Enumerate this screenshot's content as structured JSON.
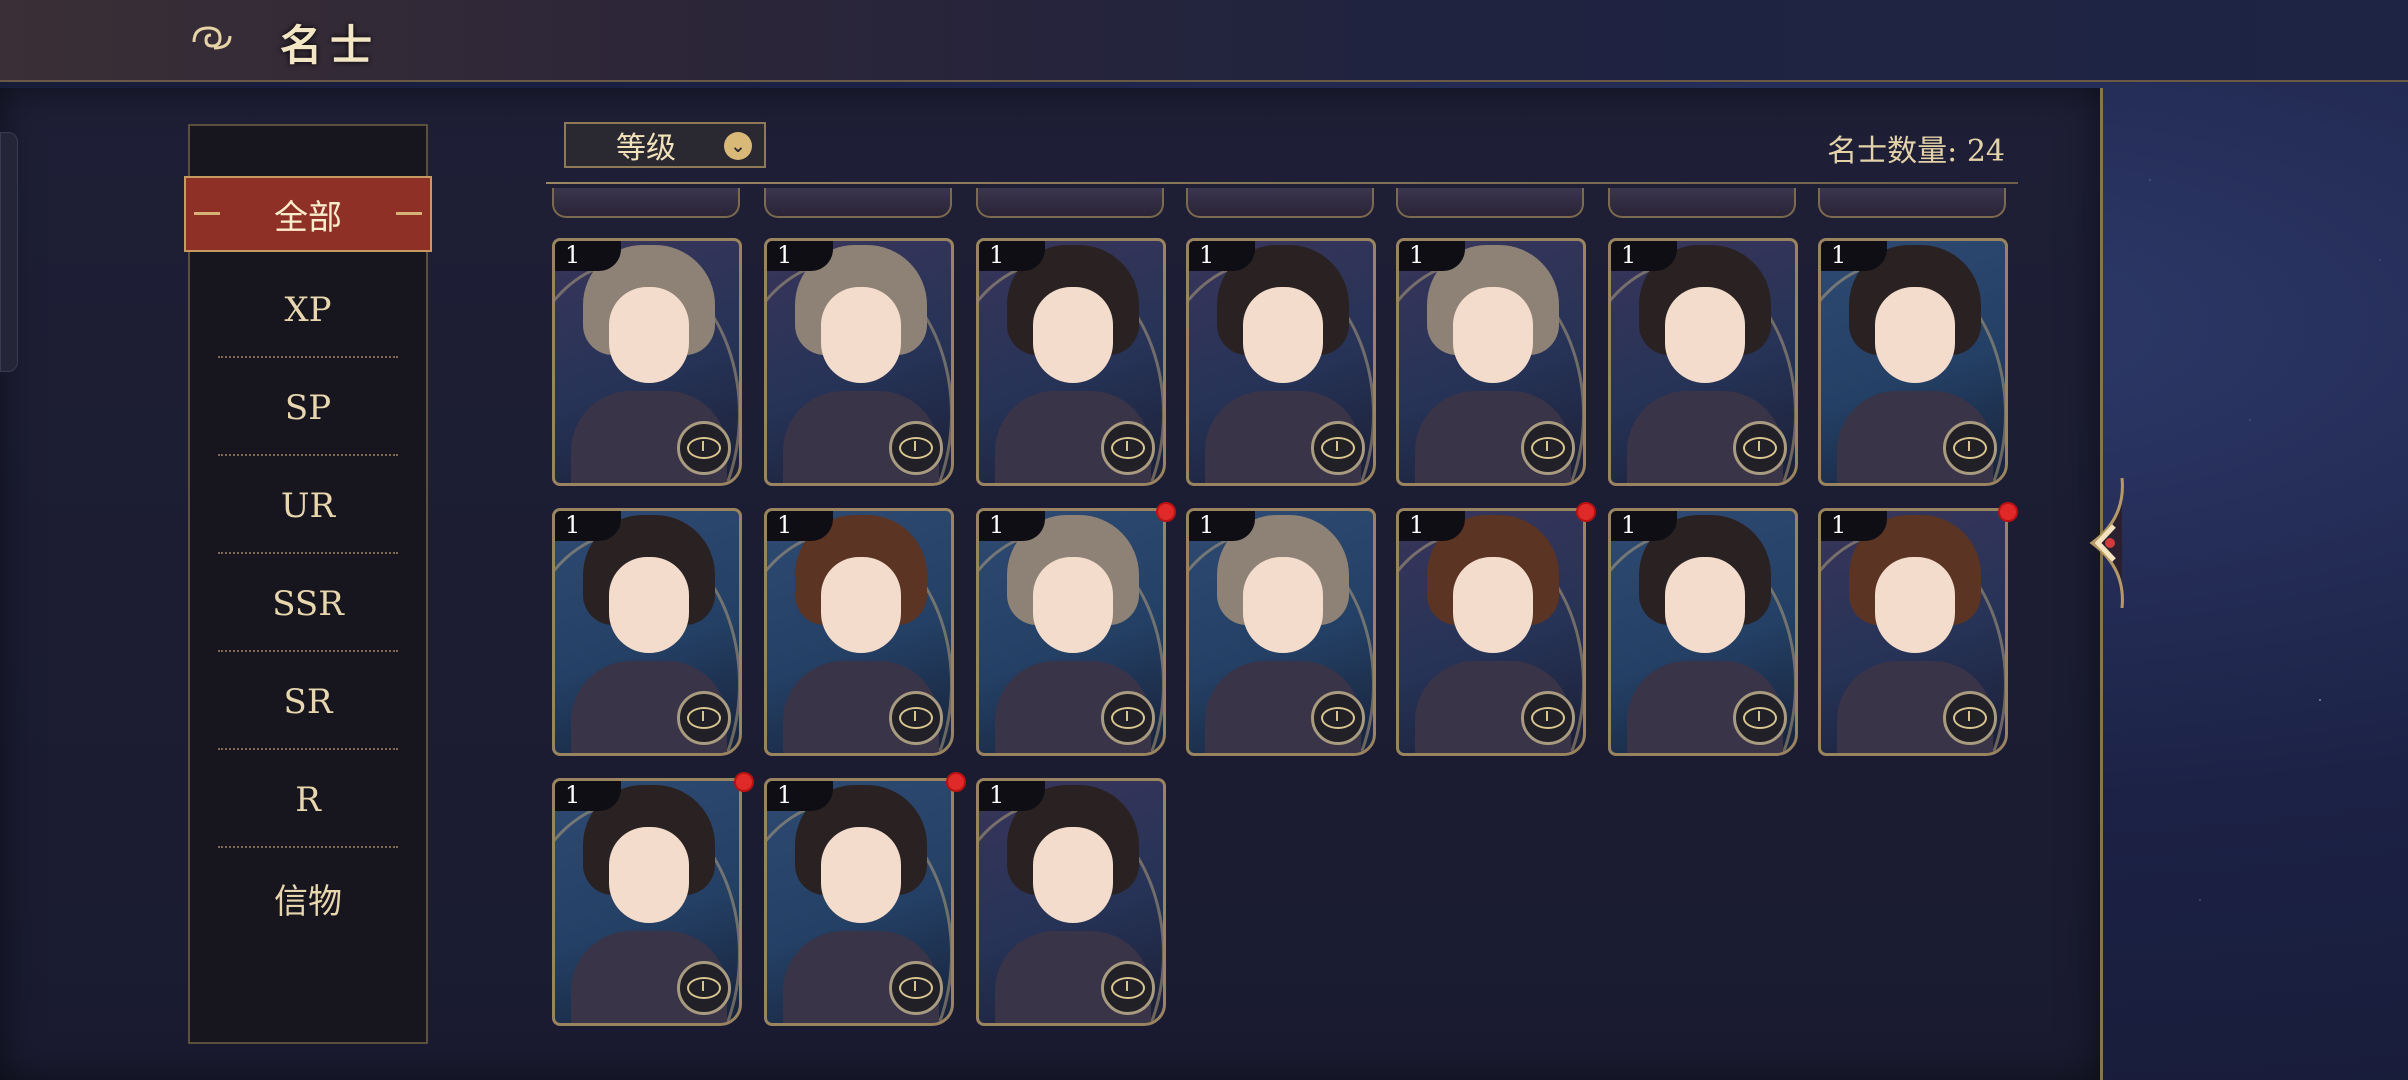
{
  "header": {
    "title": "名士",
    "icon": "cloud-swirl-icon"
  },
  "sidebar": {
    "items": [
      {
        "label": "全部",
        "active": true
      },
      {
        "label": "XP"
      },
      {
        "label": "SP"
      },
      {
        "label": "UR"
      },
      {
        "label": "SSR"
      },
      {
        "label": "SR"
      },
      {
        "label": "R"
      },
      {
        "label": "信物"
      }
    ]
  },
  "toolbar": {
    "sort_label": "等级",
    "sort_icon": "chevron-down-icon",
    "count_label": "名士数量: 24"
  },
  "cards": [
    {
      "level": "1"
    },
    {
      "level": "1"
    },
    {
      "level": "1"
    },
    {
      "level": "1"
    },
    {
      "level": "1"
    },
    {
      "level": "1"
    },
    {
      "level": "1"
    },
    {
      "level": "1"
    },
    {
      "level": "1"
    },
    {
      "level": "1"
    },
    {
      "level": "1"
    },
    {
      "level": "1"
    },
    {
      "level": "1"
    },
    {
      "level": "1"
    },
    {
      "level": "1"
    },
    {
      "level": "1"
    },
    {
      "level": "1"
    }
  ],
  "colors": {
    "accent_red": "#8e3026",
    "gold": "#c79a61",
    "notification_red": "#e02a2a"
  }
}
